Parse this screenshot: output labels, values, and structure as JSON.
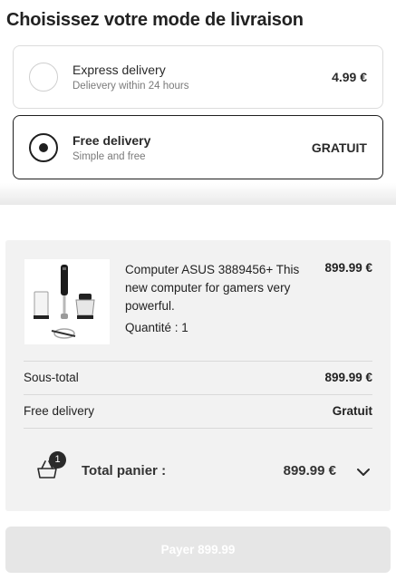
{
  "page_title": "Choisissez votre mode de livraison",
  "delivery_options": [
    {
      "name": "Express delivery",
      "subtitle": "Delievery within 24 hours",
      "price": "4.99 €",
      "selected": false
    },
    {
      "name": "Free delivery",
      "subtitle": "Simple and free",
      "price": "GRATUIT",
      "selected": true
    }
  ],
  "product": {
    "name": "Computer ASUS 3889456+ This new computer for gamers very powerful.",
    "quantity_label": "Quantité : 1",
    "price": "899.99 €",
    "image_icon": "hand-blender-set-image"
  },
  "summary": {
    "subtotal_label": "Sous-total",
    "subtotal_value": "899.99 €",
    "shipping_label": "Free delivery",
    "shipping_value": "Gratuit",
    "cart_count": "1",
    "total_label": "Total panier :",
    "total_value": "899.99 €",
    "expand_icon": "chevron-down-icon"
  },
  "pay_button": {
    "label": "Payer 899.99"
  },
  "colors": {
    "selected_border": "#1f1f1f",
    "summary_bg": "#f2f2f2",
    "pay_button_disabled": "#e6e6e6"
  }
}
